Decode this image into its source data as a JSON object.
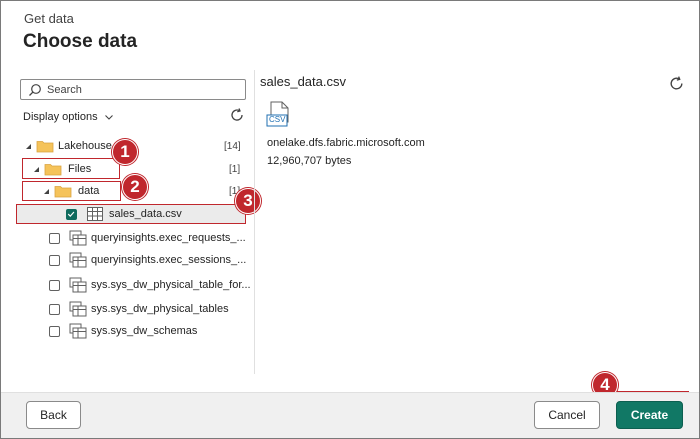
{
  "header": {
    "subtitle": "Get data",
    "title": "Choose data"
  },
  "search": {
    "placeholder": "Search",
    "icon": "search-icon"
  },
  "display_options": {
    "label": "Display options"
  },
  "tree": {
    "lakehouse": {
      "label": "Lakehouse",
      "count": "[14]"
    },
    "files": {
      "label": "Files",
      "count": "[1]"
    },
    "data": {
      "label": "data",
      "count": "[1]"
    },
    "sales_data": {
      "label": "sales_data.csv",
      "checked": true
    },
    "tables": [
      {
        "label": "queryinsights.exec_requests_...",
        "checked": false
      },
      {
        "label": "queryinsights.exec_sessions_...",
        "checked": false
      },
      {
        "label": "sys.sys_dw_physical_table_for...",
        "checked": false
      },
      {
        "label": "sys.sys_dw_physical_tables",
        "checked": false
      },
      {
        "label": "sys.sys_dw_schemas",
        "checked": false
      }
    ]
  },
  "markers": [
    "1",
    "2",
    "3",
    "4"
  ],
  "preview": {
    "file_name": "sales_data.csv",
    "file_type": "CSV",
    "path": "onelake.dfs.fabric.microsoft.com",
    "size": "12,960,707 bytes"
  },
  "footer": {
    "back_label": "Back",
    "cancel_label": "Cancel",
    "create_label": "Create"
  },
  "colors": {
    "accent": "#117865",
    "annotation_red": "#c0272d",
    "folder_yellow": "#f5c35a"
  }
}
